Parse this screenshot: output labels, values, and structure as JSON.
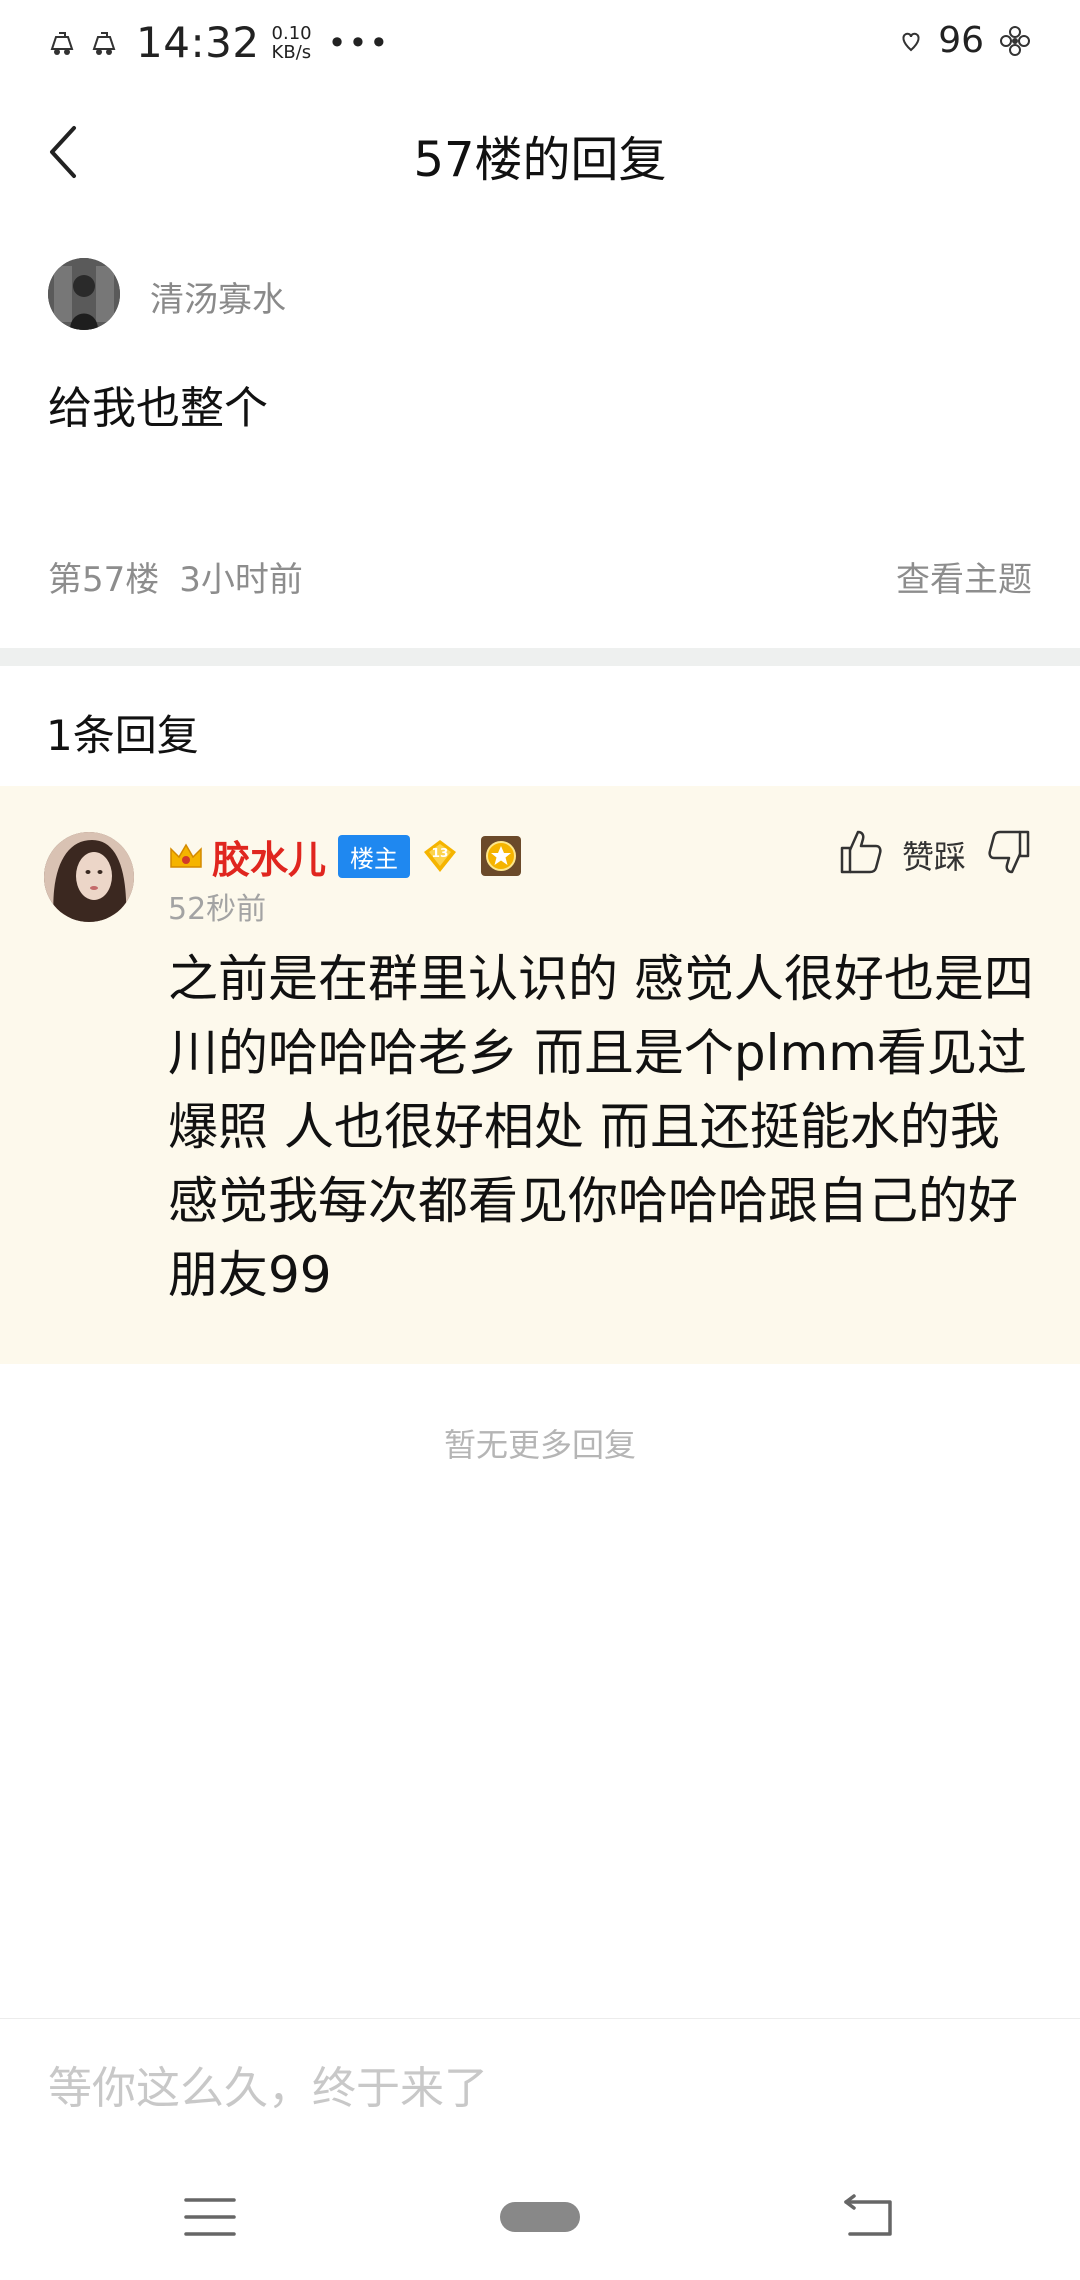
{
  "status_bar": {
    "time": "14:32",
    "speed_value": "0.10",
    "speed_unit": "KB/s",
    "dots": "•••",
    "battery": "96",
    "icons": [
      "notification-icon",
      "notification-icon",
      "heart-signal-icon",
      "flower-icon"
    ]
  },
  "header": {
    "title": "57楼的回复",
    "back_icon": "chevron-left-icon"
  },
  "original_post": {
    "author": "清汤寡水",
    "content": "给我也整个",
    "floor": "第57楼",
    "time": "3小时前",
    "view_topic": "查看主题"
  },
  "replies": {
    "count_label": "1条回复",
    "items": [
      {
        "author": "胶水儿",
        "badge": "楼主",
        "level": "13",
        "time": "52秒前",
        "vote_label": "赞踩",
        "content": "之前是在群里认识的 感觉人很好也是四川的哈哈哈老乡 而且是个plmm看见过爆照 人也很好相处 而且还挺能水的我感觉我每次都看见你哈哈哈跟自己的好朋友99"
      }
    ],
    "no_more": "暂无更多回复"
  },
  "input": {
    "placeholder": "等你这么久，终于来了"
  },
  "colors": {
    "reply_bg": "#fdf9ec",
    "name_red": "#e0261f",
    "owner_badge": "#1f88f0",
    "level_badge": "#f5b400",
    "divider": "#eef0ef"
  }
}
